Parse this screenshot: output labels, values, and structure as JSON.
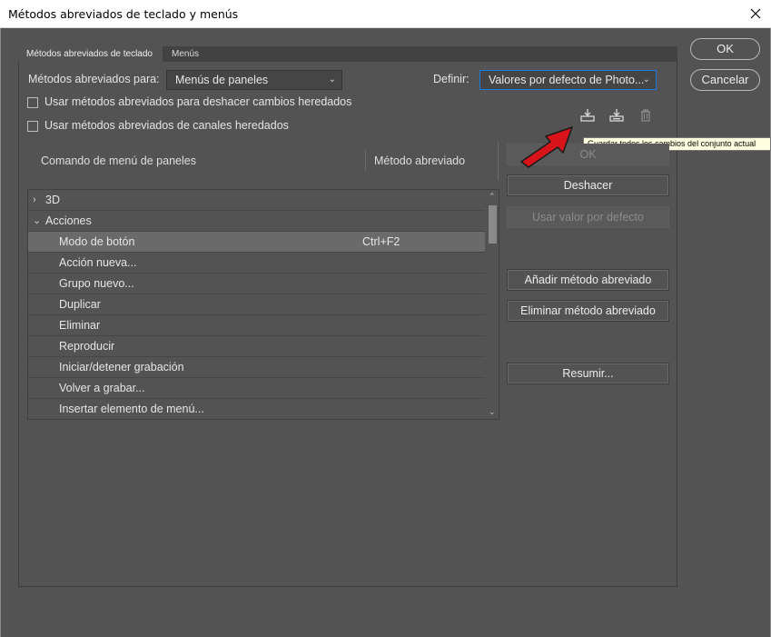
{
  "window": {
    "title": "Métodos abreviados de teclado y menús"
  },
  "tabs": [
    {
      "label": "Métodos abreviados de teclado",
      "active": true
    },
    {
      "label": "Menús",
      "active": false
    }
  ],
  "side_buttons": {
    "ok": "OK",
    "cancel": "Cancelar"
  },
  "shortcuts_for": {
    "label": "Métodos abreviados para:",
    "value": "Menús de paneles"
  },
  "set": {
    "label": "Definir:",
    "value": "Valores por defecto de Photo..."
  },
  "checkboxes": [
    {
      "label": "Usar métodos abreviados para deshacer cambios heredados",
      "checked": false
    },
    {
      "label": "Usar métodos abreviados de canales heredados",
      "checked": false
    }
  ],
  "icons": [
    "save-set-icon",
    "save-set-as-icon",
    "delete-set-icon"
  ],
  "tooltip": "Guardar todos los cambios del conjunto actual",
  "columns": {
    "command": "Comando de menú de paneles",
    "shortcut": "Método abreviado"
  },
  "rows": [
    {
      "kind": "group",
      "expanded": false,
      "label": "3D",
      "shortcut": ""
    },
    {
      "kind": "group",
      "expanded": true,
      "label": "Acciones",
      "shortcut": ""
    },
    {
      "kind": "item",
      "label": "Modo de botón",
      "shortcut": "Ctrl+F2",
      "selected": true
    },
    {
      "kind": "item",
      "label": "Acción nueva...",
      "shortcut": ""
    },
    {
      "kind": "item",
      "label": "Grupo nuevo...",
      "shortcut": ""
    },
    {
      "kind": "item",
      "label": "Duplicar",
      "shortcut": ""
    },
    {
      "kind": "item",
      "label": "Eliminar",
      "shortcut": ""
    },
    {
      "kind": "item",
      "label": "Reproducir",
      "shortcut": ""
    },
    {
      "kind": "item",
      "label": "Iniciar/detener grabación",
      "shortcut": ""
    },
    {
      "kind": "item",
      "label": "Volver a grabar...",
      "shortcut": ""
    },
    {
      "kind": "item",
      "label": "Insertar elemento de menú...",
      "shortcut": ""
    }
  ],
  "right_buttons": {
    "ok": "OK",
    "undo": "Deshacer",
    "use_default": "Usar valor por defecto",
    "add_shortcut": "Añadir método abreviado",
    "delete_shortcut": "Eliminar método abreviado",
    "summarize": "Resumir..."
  },
  "colors": {
    "accent": "#1d7ad8",
    "annotation": "#d8141a"
  }
}
